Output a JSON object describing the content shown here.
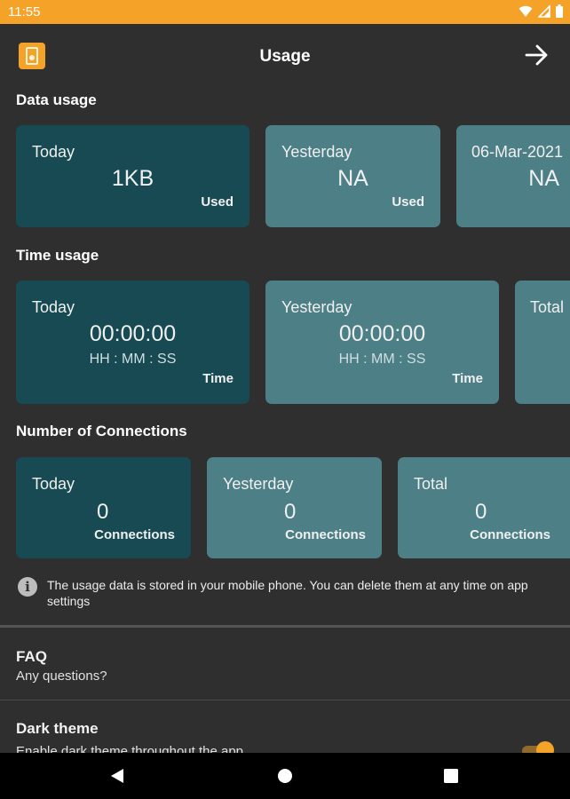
{
  "status_bar": {
    "time": "11:55"
  },
  "app_bar": {
    "title": "Usage"
  },
  "data_usage": {
    "title": "Data usage",
    "cards": [
      {
        "label": "Today",
        "value": "1KB",
        "unit": "Used"
      },
      {
        "label": "Yesterday",
        "value": "NA",
        "unit": "Used"
      },
      {
        "label": "06-Mar-2021",
        "value": "NA",
        "unit": ""
      }
    ]
  },
  "time_usage": {
    "title": "Time usage",
    "cards": [
      {
        "label": "Today",
        "value": "00:00:00",
        "sub": "HH : MM : SS",
        "unit": "Time"
      },
      {
        "label": "Yesterday",
        "value": "00:00:00",
        "sub": "HH : MM : SS",
        "unit": "Time"
      },
      {
        "label": "Total"
      }
    ]
  },
  "connections": {
    "title": "Number of Connections",
    "cards": [
      {
        "label": "Today",
        "value": "0",
        "unit": "Connections"
      },
      {
        "label": "Yesterday",
        "value": "0",
        "unit": "Connections"
      },
      {
        "label": "Total",
        "value": "0",
        "unit": "Connections"
      }
    ]
  },
  "info": {
    "text": "The usage data is stored in your mobile phone. You can delete them at any time on app settings"
  },
  "settings": {
    "faq": {
      "title": "FAQ",
      "subtitle": "Any questions?"
    },
    "dark_theme": {
      "title": "Dark theme",
      "subtitle": "Enable dark theme throughout the app",
      "enabled": true
    }
  },
  "colors": {
    "accent": "#f4a228",
    "card_dark": "#174a52",
    "card_light": "#4d7f87",
    "background": "#2f2f2f"
  },
  "icons": [
    "wifi-icon",
    "signal-icon",
    "battery-icon",
    "app-logo-icon",
    "arrow-forward-icon",
    "info-icon",
    "nav-back-icon",
    "nav-home-icon",
    "nav-recents-icon"
  ]
}
